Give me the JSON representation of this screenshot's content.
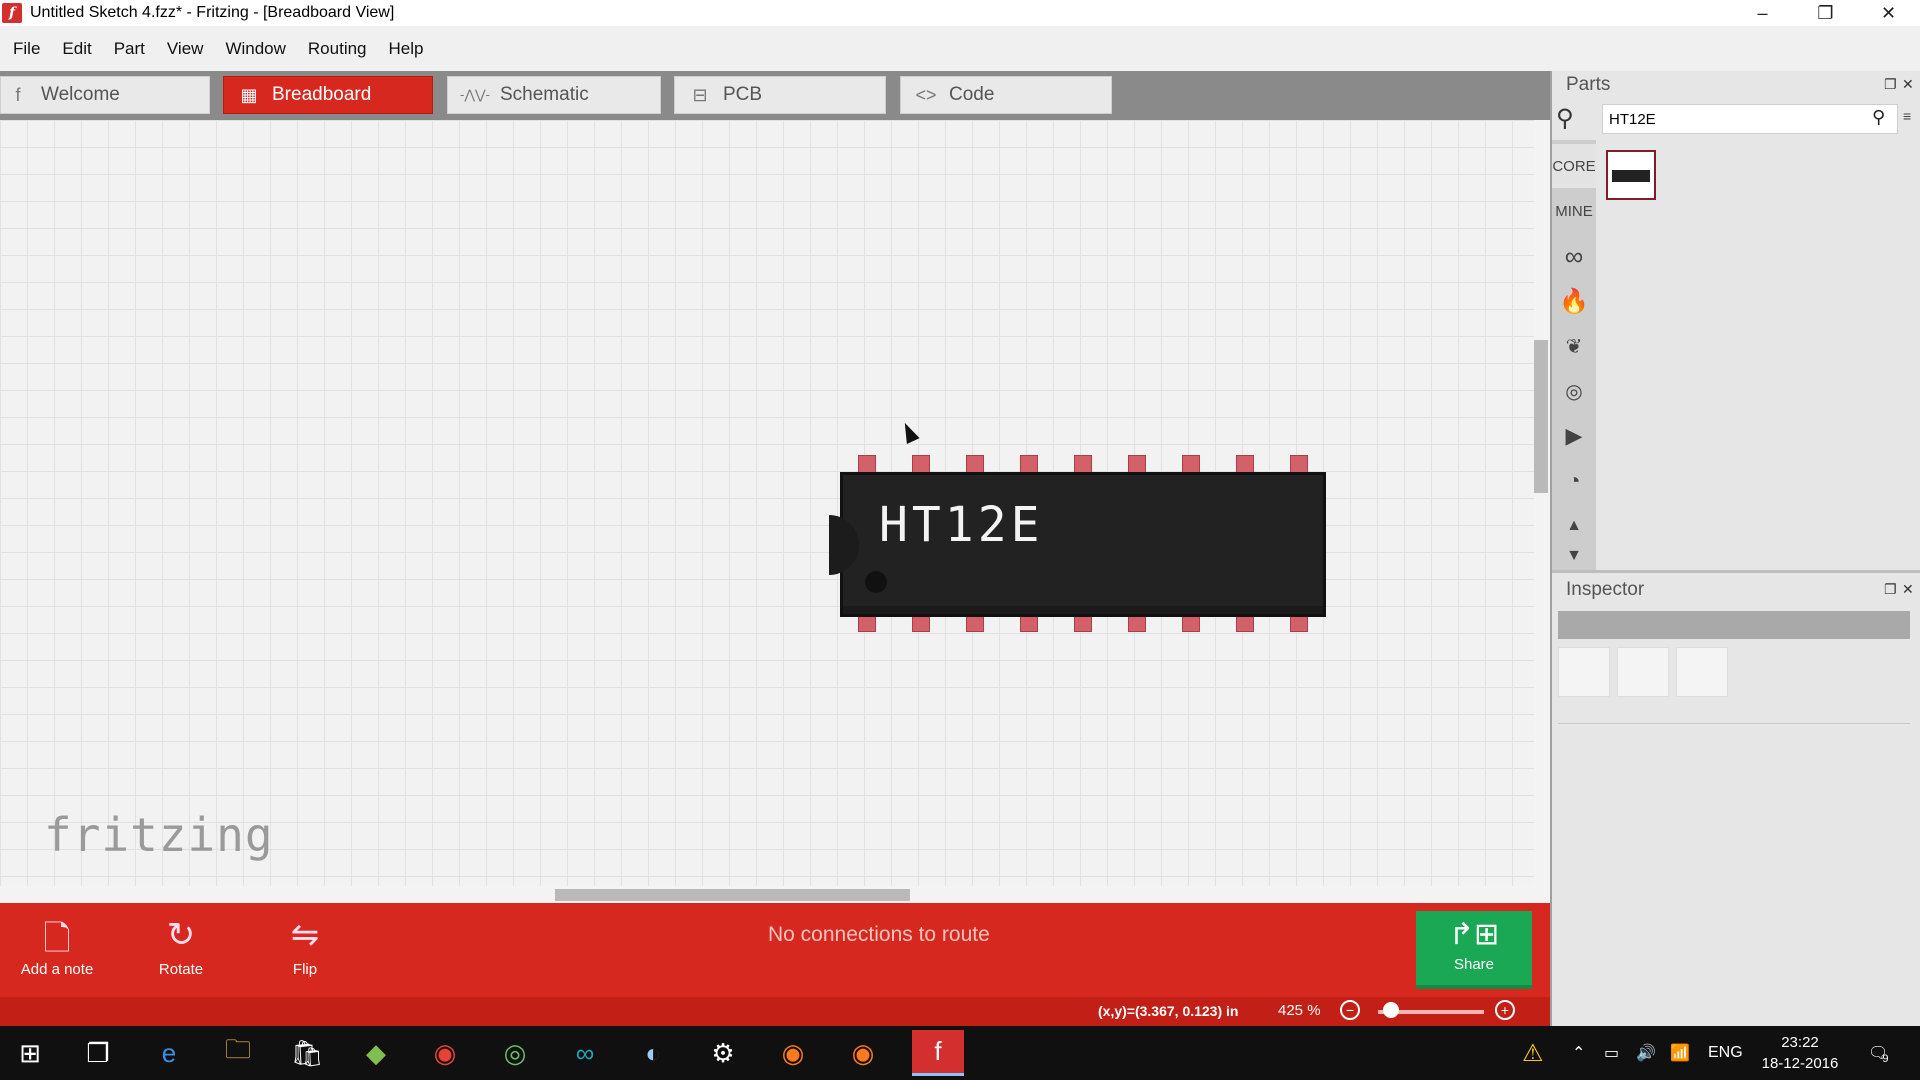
{
  "window": {
    "title": "Untitled Sketch 4.fzz* - Fritzing - [Breadboard View]",
    "app_icon_letter": "f",
    "minimize": "–",
    "restore": "❐",
    "close": "✕"
  },
  "menu": [
    "File",
    "Edit",
    "Part",
    "View",
    "Window",
    "Routing",
    "Help"
  ],
  "tabs": [
    {
      "label": "Welcome",
      "icon": "f"
    },
    {
      "label": "Breadboard",
      "icon": "▦"
    },
    {
      "label": "Schematic",
      "icon": "-⋀⋁-"
    },
    {
      "label": "PCB",
      "icon": "⊟"
    },
    {
      "label": "Code",
      "icon": "<>"
    }
  ],
  "canvas": {
    "logo": "fritzing",
    "chip_label": "HT12E"
  },
  "toolbar": {
    "add_note": "Add a note",
    "rotate": "Rotate",
    "flip": "Flip",
    "route_message": "No connections to route",
    "share": "Share"
  },
  "status": {
    "coordinates": "(x,y)=(3.367, 0.123) in",
    "zoom": "425 %"
  },
  "parts": {
    "title": "Parts",
    "search_value": "HT12E",
    "bins": [
      "CORE",
      "MINE"
    ]
  },
  "inspector": {
    "title": "Inspector"
  },
  "taskbar": {
    "language": "ENG",
    "time": "23:22",
    "date": "18-12-2016",
    "notification_count": "9"
  }
}
